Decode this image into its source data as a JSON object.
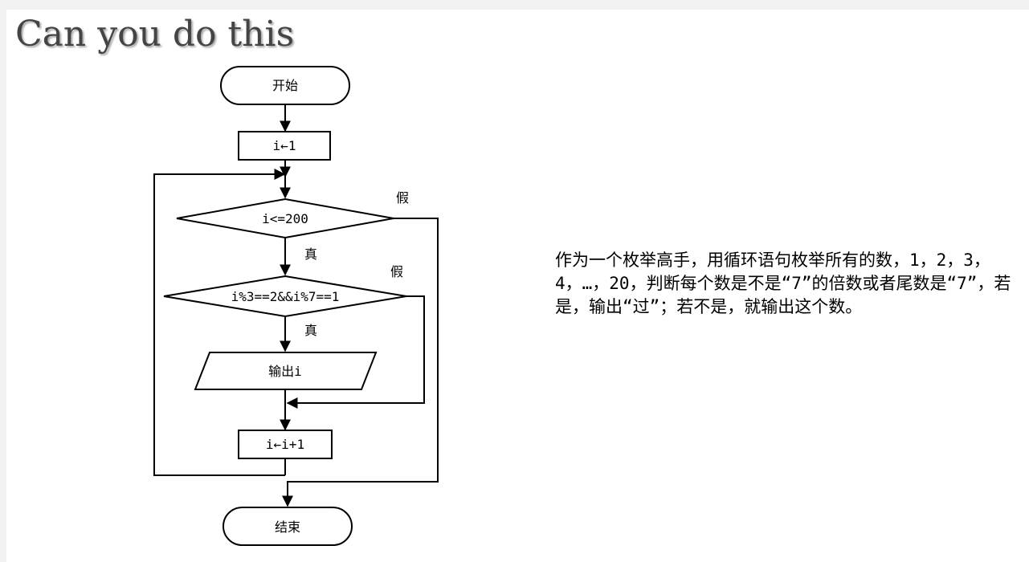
{
  "slide": {
    "title": "Can you do this"
  },
  "flowchart": {
    "start": "开始",
    "init": "i←1",
    "cond1": "i<=200",
    "cond1_false": "假",
    "cond1_true": "真",
    "cond2": "i%3==2&&i%7==1",
    "cond2_false": "假",
    "cond2_true": "真",
    "output": "输出i",
    "increment": "i←i+1",
    "end": "结束"
  },
  "description": "作为一个枚举高手，用循环语句枚举所有的数，1，2，3，4，…，20，判断每个数是不是“7”的倍数或者尾数是“7”，若是，输出“过”；若不是，就输出这个数。"
}
